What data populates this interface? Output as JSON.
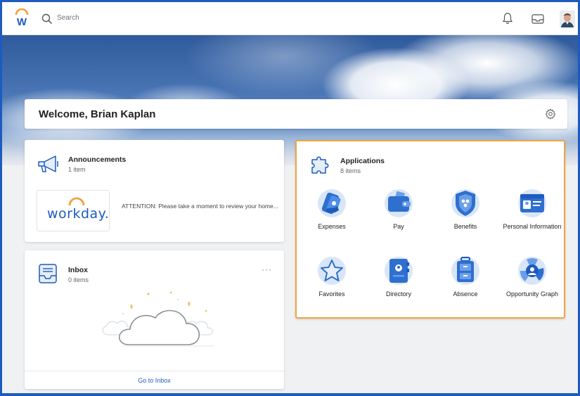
{
  "topbar": {
    "logo_letter": "W",
    "search_placeholder": "Search",
    "icons": [
      "search-icon",
      "bell-icon",
      "inbox-tray-icon",
      "avatar"
    ]
  },
  "welcome": {
    "title": "Welcome, Brian Kaplan"
  },
  "announcements": {
    "title": "Announcements",
    "count": "1 item",
    "logo_text": "workday.",
    "message": "ATTENTION: Please take a moment to review your home..."
  },
  "inbox": {
    "title": "Inbox",
    "count": "0 items",
    "more": "···",
    "link": "Go to Inbox"
  },
  "applications": {
    "title": "Applications",
    "count": "8 items",
    "items": [
      {
        "label": "Expenses",
        "icon": "expenses-icon"
      },
      {
        "label": "Pay",
        "icon": "wallet-icon"
      },
      {
        "label": "Benefits",
        "icon": "shield-icon"
      },
      {
        "label": "Personal Information",
        "icon": "id-card-icon"
      },
      {
        "label": "Favorites",
        "icon": "star-icon"
      },
      {
        "label": "Directory",
        "icon": "address-book-icon"
      },
      {
        "label": "Absence",
        "icon": "luggage-icon"
      },
      {
        "label": "Opportunity Graph",
        "icon": "opportunity-graph-icon"
      }
    ]
  },
  "colors": {
    "accent_blue": "#1d5bbf",
    "highlight_orange": "#f2a43c",
    "logo_orange": "#f2a03a"
  }
}
